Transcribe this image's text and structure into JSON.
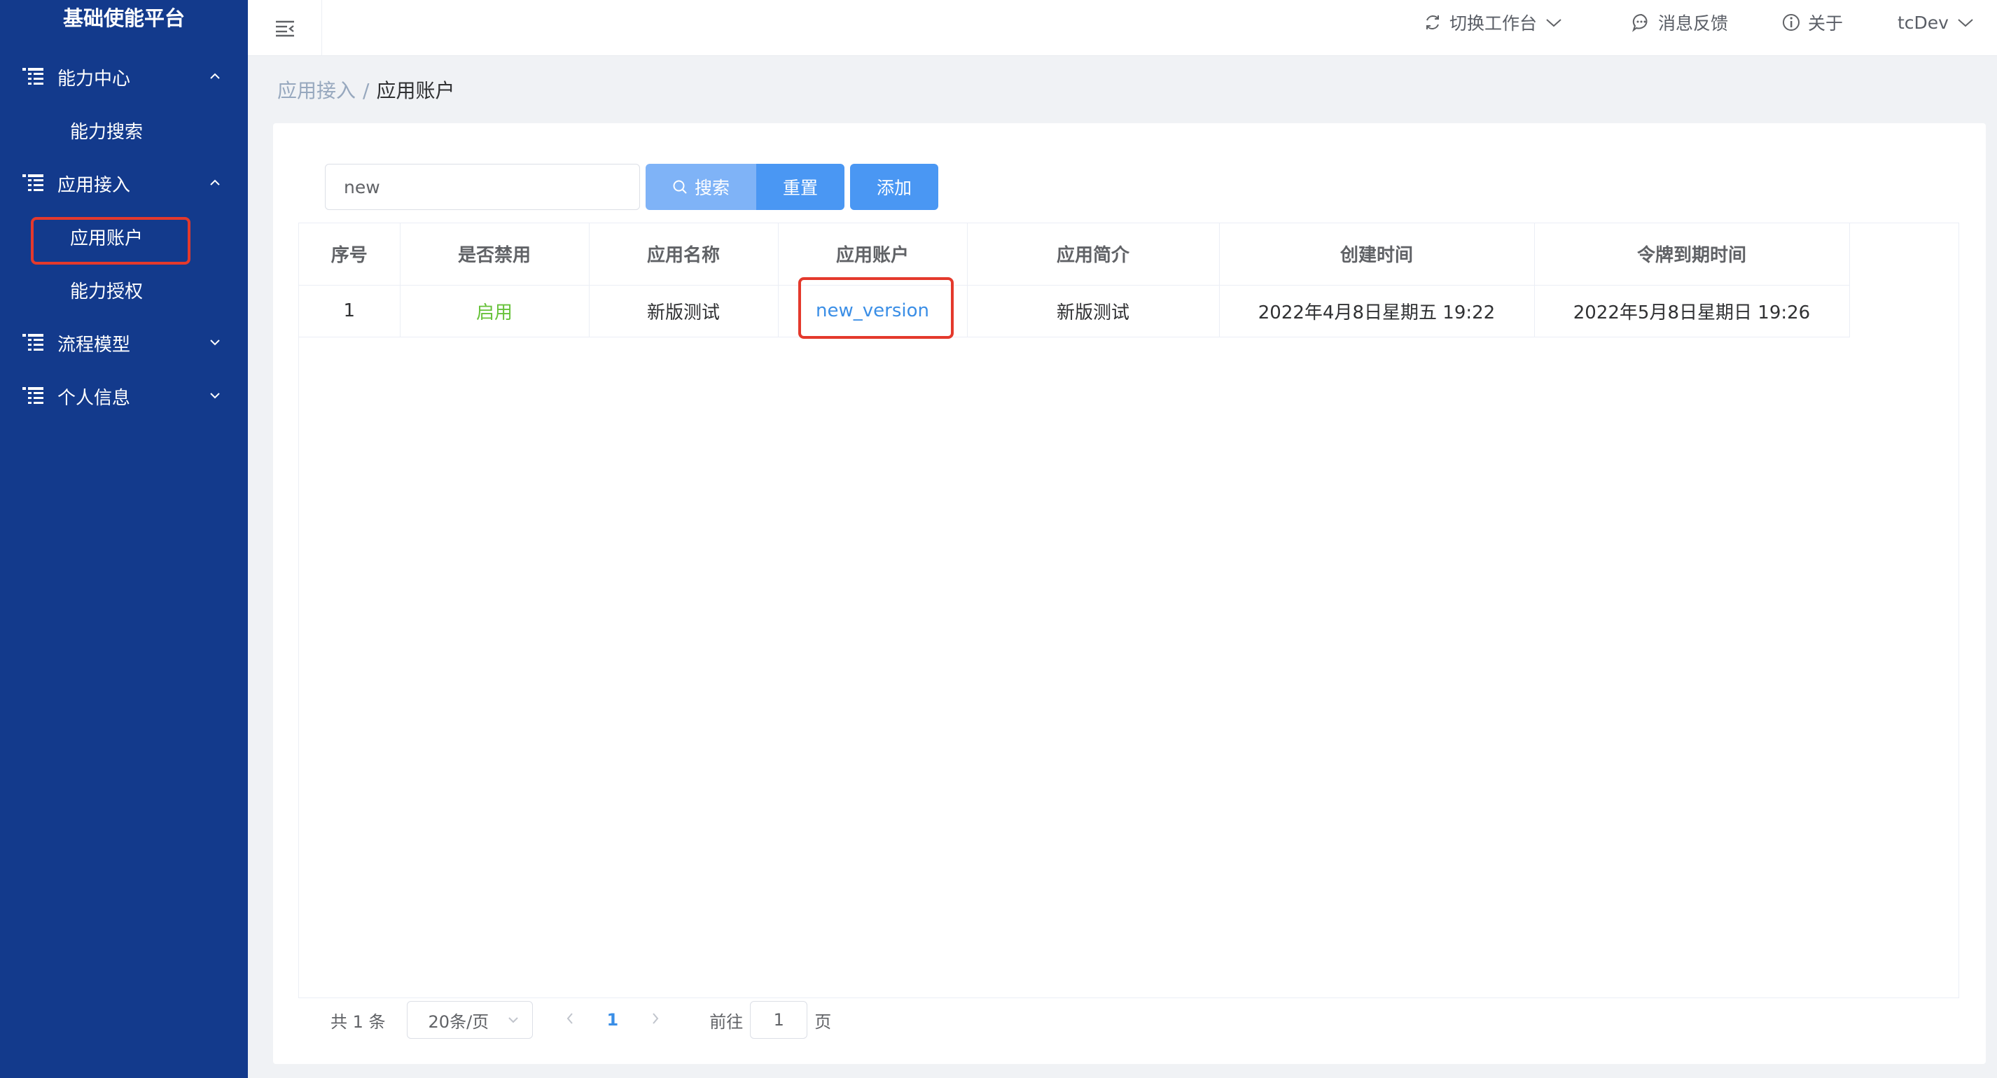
{
  "app": {
    "title": "基础使能平台"
  },
  "sidebar": {
    "groups": [
      {
        "label": "能力中心",
        "expanded": true,
        "items": [
          {
            "label": "能力搜索"
          }
        ]
      },
      {
        "label": "应用接入",
        "expanded": true,
        "items": [
          {
            "label": "应用账户"
          },
          {
            "label": "能力授权"
          }
        ]
      },
      {
        "label": "流程模型",
        "expanded": false,
        "items": []
      },
      {
        "label": "个人信息",
        "expanded": false,
        "items": []
      }
    ]
  },
  "header": {
    "switch_workspace": "切换工作台",
    "feedback": "消息反馈",
    "about": "关于",
    "user": "tcDev"
  },
  "breadcrumb": {
    "parent": "应用接入",
    "separator": "/",
    "current": "应用账户"
  },
  "search": {
    "value": "new",
    "search_label": "搜索",
    "reset_label": "重置",
    "add_label": "添加"
  },
  "table": {
    "columns": [
      "序号",
      "是否禁用",
      "应用名称",
      "应用账户",
      "应用简介",
      "创建时间",
      "令牌到期时间"
    ],
    "rows": [
      {
        "index": "1",
        "status": "启用",
        "name": "新版测试",
        "account": "new_version",
        "desc": "新版测试",
        "created": "2022年4月8日星期五 19:22",
        "expires": "2022年5月8日星期日 19:26"
      }
    ]
  },
  "pagination": {
    "total_text": "共 1 条",
    "page_size": "20条/页",
    "current_page": "1",
    "goto_prefix": "前往",
    "goto_value": "1",
    "goto_suffix": "页"
  },
  "colors": {
    "sidebar_bg": "#133a8c",
    "primary": "#4a97f3",
    "status_enabled": "#67c23a",
    "highlight_box": "#e4392c"
  }
}
